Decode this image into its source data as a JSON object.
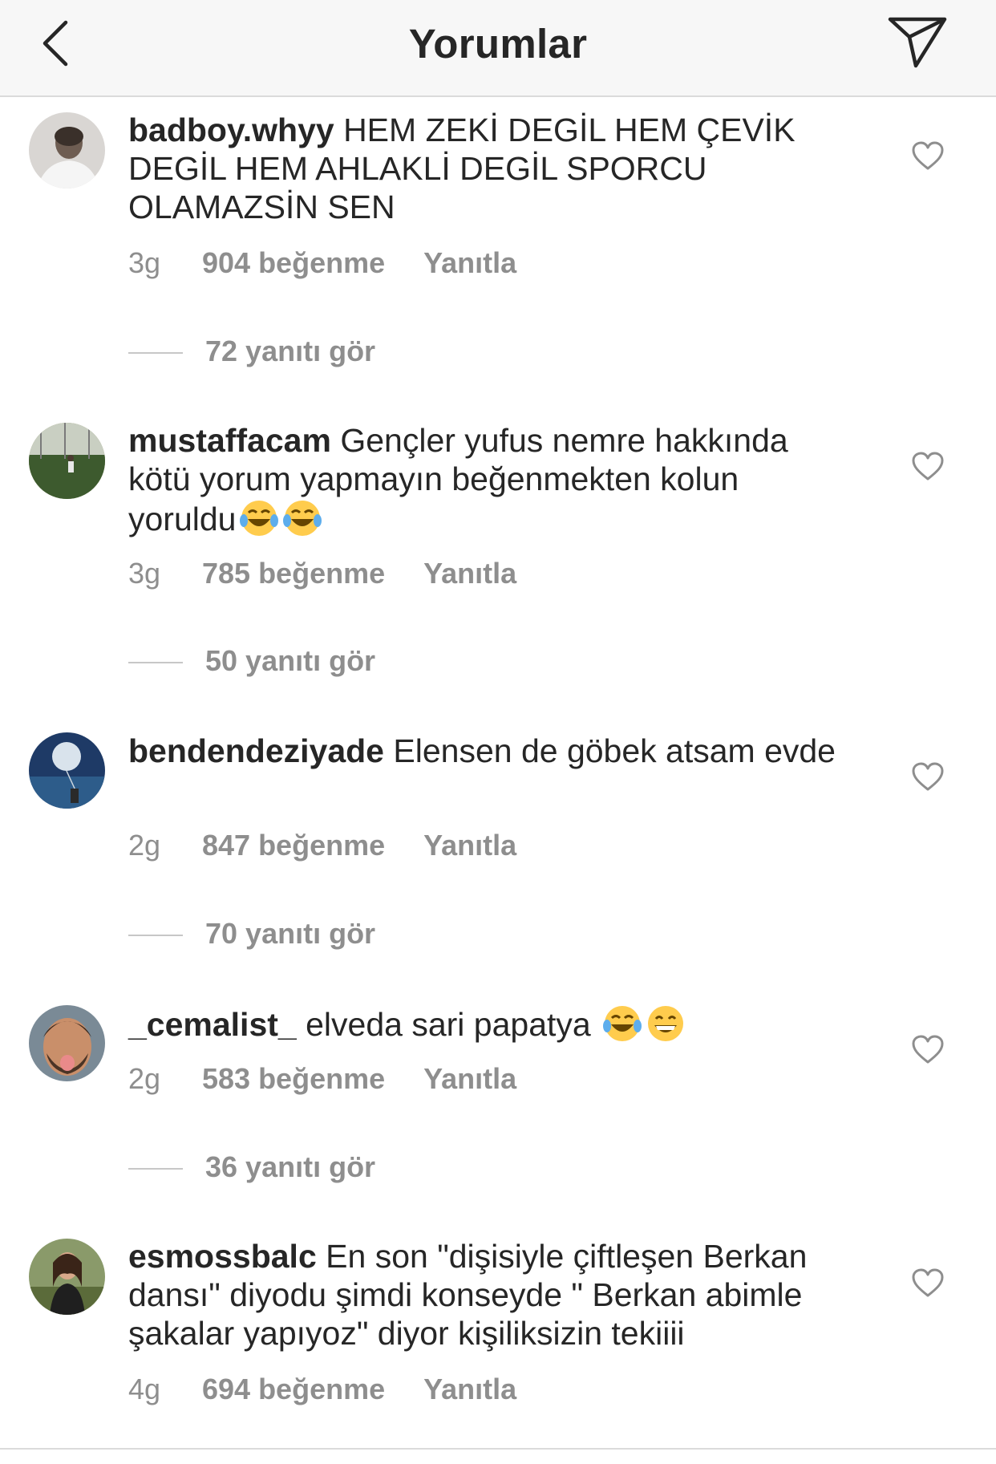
{
  "header": {
    "title": "Yorumlar",
    "back_icon": "chevron-left-icon",
    "send_icon": "paper-plane-icon"
  },
  "comments": [
    {
      "username": "badboy.whyy",
      "text": "HEM ZEKİ DEGİL HEM ÇEVİK DEGİL HEM AHLAKLİ DEGİL SPORCU OLAMAZSİN SEN",
      "emojis": [],
      "time": "3g",
      "likes": "904 beğenme",
      "reply_label": "Yanıtla",
      "view_replies": "72 yanıtı gör"
    },
    {
      "username": "mustaffacam",
      "text": "Gençler yufus nemre hakkında kötü yorum yapmayın beğenmekten kolun yoruldu",
      "emojis": [
        "tears-of-joy-emoji",
        "tears-of-joy-emoji"
      ],
      "time": "3g",
      "likes": "785 beğenme",
      "reply_label": "Yanıtla",
      "view_replies": "50 yanıtı gör"
    },
    {
      "username": "bendendeziyade",
      "text": "Elensen de göbek atsam evde",
      "emojis": [],
      "time": "2g",
      "likes": "847 beğenme",
      "reply_label": "Yanıtla",
      "view_replies": "70 yanıtı gör"
    },
    {
      "username": "_cemalist_",
      "text": "elveda  sari papatya",
      "emojis": [
        "tears-of-joy-emoji",
        "grinning-face-emoji"
      ],
      "time": "2g",
      "likes": "583 beğenme",
      "reply_label": "Yanıtla",
      "view_replies": "36 yanıtı gör"
    },
    {
      "username": "esmossbalc",
      "text": "En son \"dişisiyle çiftleşen Berkan dansı\" diyodu şimdi konseyde \" Berkan abimle şakalar yapıyoz\" diyor kişiliksizin tekiiii",
      "emojis": [],
      "time": "4g",
      "likes": "694 beğenme",
      "reply_label": "Yanıtla"
    }
  ],
  "colors": {
    "text": "#262626",
    "secondary": "#8e8e8e",
    "divider": "#dbdbdb",
    "header_bg": "#f7f7f7"
  }
}
